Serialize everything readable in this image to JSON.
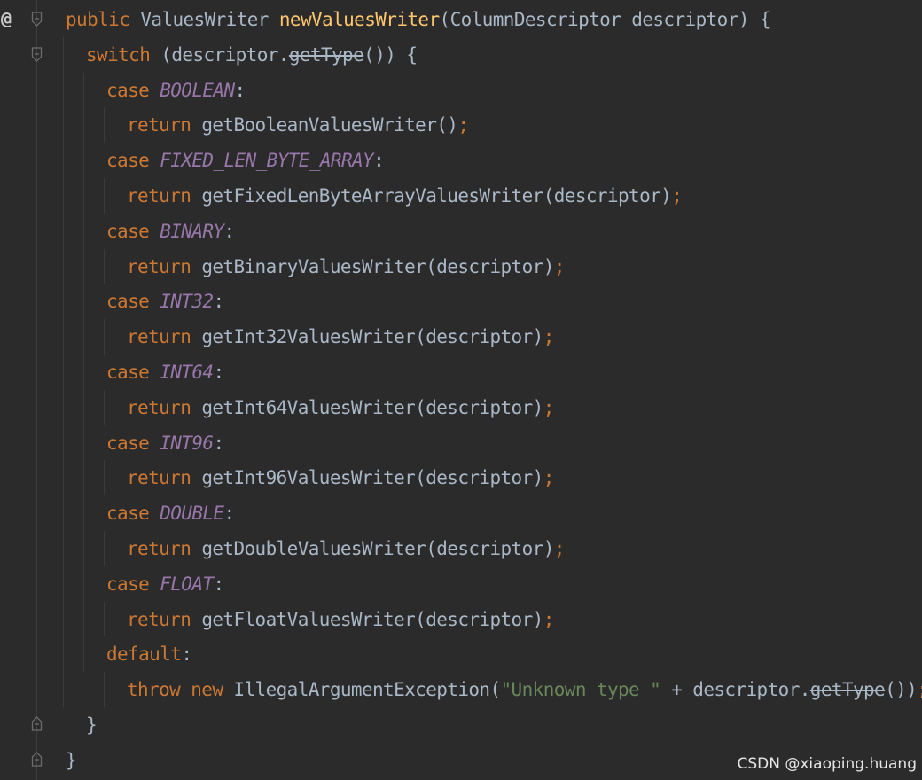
{
  "editor": {
    "gutter": {
      "override_marker": "@"
    },
    "lines": [
      [
        {
          "t": "public ",
          "c": "kw"
        },
        {
          "t": "ValuesWriter ",
          "c": "type"
        },
        {
          "t": "newValuesWriter",
          "c": "fn"
        },
        {
          "t": "(ColumnDescriptor descriptor) {",
          "c": "plain"
        }
      ],
      [
        {
          "t": "switch ",
          "c": "kw"
        },
        {
          "t": "(descriptor.",
          "c": "plain"
        },
        {
          "t": "getType",
          "c": "dep"
        },
        {
          "t": "()) {",
          "c": "plain"
        }
      ],
      [
        {
          "t": "case ",
          "c": "kw"
        },
        {
          "t": "BOOLEAN",
          "c": "const"
        },
        {
          "t": ":",
          "c": "plain"
        }
      ],
      [
        {
          "t": "return ",
          "c": "kw"
        },
        {
          "t": "getBooleanValuesWriter()",
          "c": "plain"
        },
        {
          "t": ";",
          "c": "punct"
        }
      ],
      [
        {
          "t": "case ",
          "c": "kw"
        },
        {
          "t": "FIXED_LEN_BYTE_ARRAY",
          "c": "const"
        },
        {
          "t": ":",
          "c": "plain"
        }
      ],
      [
        {
          "t": "return ",
          "c": "kw"
        },
        {
          "t": "getFixedLenByteArrayValuesWriter(descriptor)",
          "c": "plain"
        },
        {
          "t": ";",
          "c": "punct"
        }
      ],
      [
        {
          "t": "case ",
          "c": "kw"
        },
        {
          "t": "BINARY",
          "c": "const"
        },
        {
          "t": ":",
          "c": "plain"
        }
      ],
      [
        {
          "t": "return ",
          "c": "kw"
        },
        {
          "t": "getBinaryValuesWriter(descriptor)",
          "c": "plain"
        },
        {
          "t": ";",
          "c": "punct"
        }
      ],
      [
        {
          "t": "case ",
          "c": "kw"
        },
        {
          "t": "INT32",
          "c": "const"
        },
        {
          "t": ":",
          "c": "plain"
        }
      ],
      [
        {
          "t": "return ",
          "c": "kw"
        },
        {
          "t": "getInt32ValuesWriter(descriptor)",
          "c": "plain"
        },
        {
          "t": ";",
          "c": "punct"
        }
      ],
      [
        {
          "t": "case ",
          "c": "kw"
        },
        {
          "t": "INT64",
          "c": "const"
        },
        {
          "t": ":",
          "c": "plain"
        }
      ],
      [
        {
          "t": "return ",
          "c": "kw"
        },
        {
          "t": "getInt64ValuesWriter(descriptor)",
          "c": "plain"
        },
        {
          "t": ";",
          "c": "punct"
        }
      ],
      [
        {
          "t": "case ",
          "c": "kw"
        },
        {
          "t": "INT96",
          "c": "const"
        },
        {
          "t": ":",
          "c": "plain"
        }
      ],
      [
        {
          "t": "return ",
          "c": "kw"
        },
        {
          "t": "getInt96ValuesWriter(descriptor)",
          "c": "plain"
        },
        {
          "t": ";",
          "c": "punct"
        }
      ],
      [
        {
          "t": "case ",
          "c": "kw"
        },
        {
          "t": "DOUBLE",
          "c": "const"
        },
        {
          "t": ":",
          "c": "plain"
        }
      ],
      [
        {
          "t": "return ",
          "c": "kw"
        },
        {
          "t": "getDoubleValuesWriter(descriptor)",
          "c": "plain"
        },
        {
          "t": ";",
          "c": "punct"
        }
      ],
      [
        {
          "t": "case ",
          "c": "kw"
        },
        {
          "t": "FLOAT",
          "c": "const"
        },
        {
          "t": ":",
          "c": "plain"
        }
      ],
      [
        {
          "t": "return ",
          "c": "kw"
        },
        {
          "t": "getFloatValuesWriter(descriptor)",
          "c": "plain"
        },
        {
          "t": ";",
          "c": "punct"
        }
      ],
      [
        {
          "t": "default",
          "c": "kw"
        },
        {
          "t": ":",
          "c": "plain"
        }
      ],
      [
        {
          "t": "throw new ",
          "c": "kw"
        },
        {
          "t": "IllegalArgumentException(",
          "c": "plain"
        },
        {
          "t": "\"Unknown type \"",
          "c": "str"
        },
        {
          "t": " + descriptor.",
          "c": "plain"
        },
        {
          "t": "getType",
          "c": "dep"
        },
        {
          "t": "())",
          "c": "plain"
        },
        {
          "t": ";",
          "c": "punct"
        }
      ],
      [
        {
          "t": "}",
          "c": "plain"
        }
      ],
      [
        {
          "t": "}",
          "c": "plain"
        }
      ]
    ],
    "indent_levels": [
      0,
      1,
      2,
      3,
      2,
      3,
      2,
      3,
      2,
      3,
      2,
      3,
      2,
      3,
      2,
      3,
      2,
      3,
      2,
      3,
      1,
      0
    ]
  },
  "watermark": "CSDN @xiaoping.huang",
  "colors": {
    "background": "#2b2b2b",
    "keyword": "#cc7832",
    "method_declaration": "#ffc66d",
    "plain": "#a9b7c6",
    "constant": "#9876aa",
    "string": "#6a8759"
  }
}
